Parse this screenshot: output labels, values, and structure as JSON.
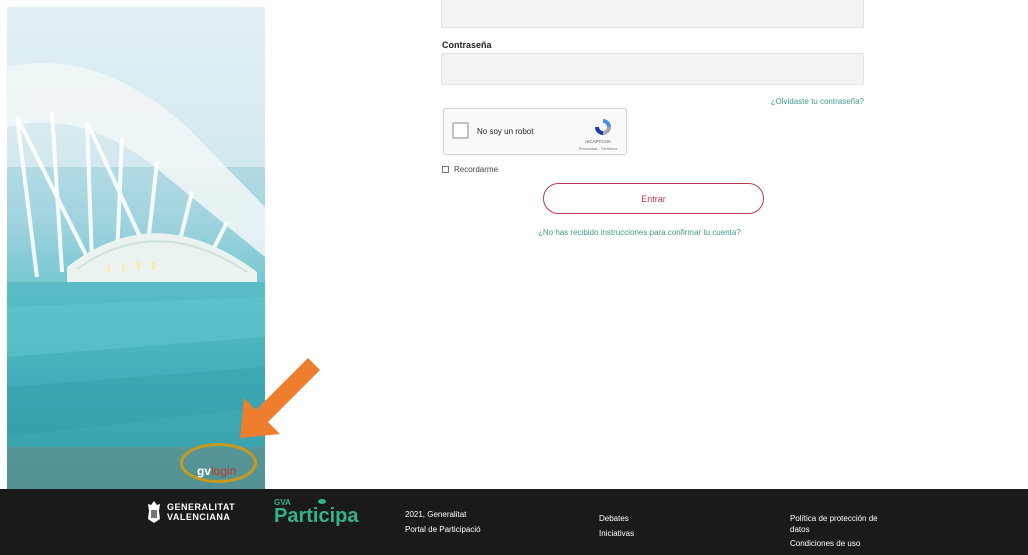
{
  "form": {
    "password_label": "Contraseña",
    "password_value": "",
    "forgot_link": "¿Olvidaste tu contraseña?",
    "captcha": {
      "label": "No soy un robot",
      "brand": "reCAPTCHA",
      "terms": "Privacidad - Términos"
    },
    "remember_label": "Recordarme",
    "submit_label": "Entrar",
    "resend_link": "¿No has recibido instrucciones para confirmar tu cuenta?"
  },
  "hero": {
    "logo_gv": "gv",
    "logo_login": "login"
  },
  "footer": {
    "generalitat_line1": "GENERALITAT",
    "generalitat_line2": "VALENCIANA",
    "gva": "GVA",
    "participa": "Participa",
    "copyright_line1": "2021, Generalitat",
    "copyright_line2": "Portal de Participació",
    "nav": [
      "Debates",
      "Iniciativas"
    ],
    "legal": [
      "Política de protección de",
      "datos",
      "Condiciones de uso"
    ]
  },
  "colors": {
    "accent_teal": "#3f9c8a",
    "button_red": "#c0394f",
    "footer_bg": "#1a1a1a",
    "participa_green": "#34b38a",
    "annotation_orange": "#ee7d2d",
    "annotation_ring": "#c99a1a"
  },
  "icons": {
    "recaptcha": "recaptcha-icon",
    "crest": "generalitat-crest-icon",
    "arrow": "annotation-arrow-icon"
  }
}
